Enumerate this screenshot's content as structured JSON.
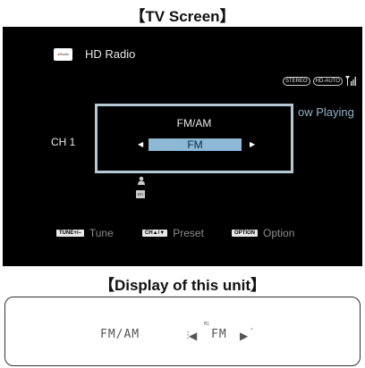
{
  "labels": {
    "tv_screen": "【TV Screen】",
    "unit_display": "【Display of this unit】"
  },
  "tv": {
    "logo": {
      "dot": "●",
      "text": "Radio"
    },
    "app_title": "HD Radio",
    "indicators": [
      "STEREO",
      "HD-AUTO"
    ],
    "now_playing": "ow Playing",
    "channel": "CH 1",
    "dialog": {
      "title": "FM/AM",
      "selected_band": "FM"
    },
    "rds_icon_text": "RTI",
    "help": [
      {
        "key": "TUNE+/–",
        "label": "Tune"
      },
      {
        "key": "CH▲/▼",
        "label": "Preset"
      },
      {
        "key": "OPTION",
        "label": "Option"
      }
    ]
  },
  "unit": {
    "mode": "FM/AM",
    "band": "FM",
    "superscript": "M1"
  },
  "colors": {
    "tv_background": "#000000",
    "dialog_border": "#b5c8d6",
    "band_highlight": "#8db8d6",
    "now_playing_text": "#8fb4cc"
  }
}
